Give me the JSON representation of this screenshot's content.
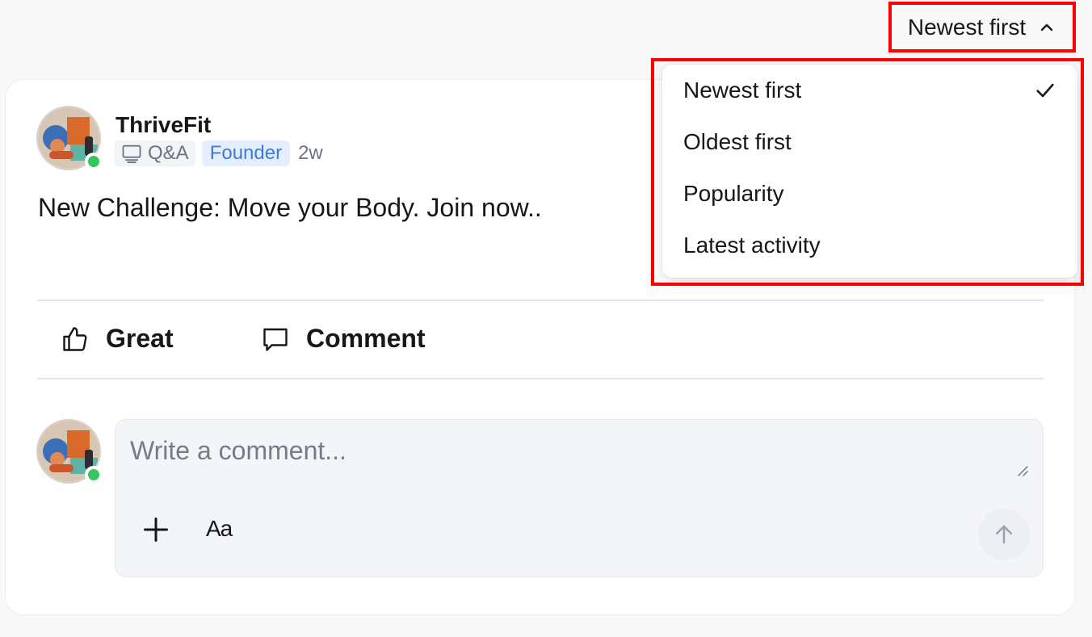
{
  "sort": {
    "current_label": "Newest first",
    "options": [
      {
        "label": "Newest first",
        "selected": true
      },
      {
        "label": "Oldest first",
        "selected": false
      },
      {
        "label": "Popularity",
        "selected": false
      },
      {
        "label": "Latest activity",
        "selected": false
      }
    ]
  },
  "post": {
    "author": "ThriveFit",
    "space": "Q&A",
    "role": "Founder",
    "time": "2w",
    "body": "New Challenge: Move your Body. Join now.."
  },
  "actions": {
    "like_label": "Great",
    "comment_label": "Comment"
  },
  "composer": {
    "placeholder": "Write a comment...",
    "format_label": "Aa"
  },
  "colors": {
    "accent_blue": "#3b7ae0",
    "online_green": "#36c75a",
    "highlight_red": "#ff0000"
  }
}
